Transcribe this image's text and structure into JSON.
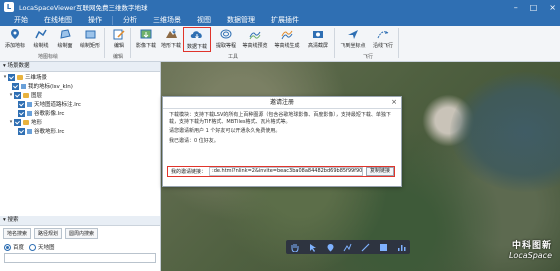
{
  "window": {
    "title": "LocaSpaceViewer互联网免费三维数字地球"
  },
  "menu": [
    "开始",
    "在线地图",
    "操作",
    "分析",
    "三维场景",
    "视图",
    "数据管理",
    "扩展插件"
  ],
  "ribbon": {
    "buttons": [
      "添加地标",
      "绘制线",
      "绘制面",
      "绘制矩形",
      "编辑",
      "影像下载",
      "地形下载",
      "数据下载",
      "提取等程",
      "等高线预览",
      "等高线生成",
      "高清截屏",
      "飞到坐标点",
      "沿线飞行"
    ],
    "groups": [
      "地图标绘",
      "编辑",
      "工具",
      "飞行"
    ]
  },
  "left_panel": {
    "scene_header": "场景数据",
    "tree": [
      "三维场景",
      "我的地标(lsv_kln)",
      "图层",
      "天地图道路标注.lrc",
      "谷歌影像.lrc",
      "地形",
      "谷歌地形.lrc"
    ],
    "search_header": "搜索",
    "search_tabs": [
      "地名搜索",
      "路径规划",
      "圆周内搜索"
    ],
    "sources": [
      "百度",
      "天地图"
    ]
  },
  "dialog": {
    "title": "邀请注册",
    "close": "×",
    "para1": "下载模块：支持下载LSV的所有上百种图源（包含谷歌地球影像、百度影像），支持最短下载、单独下载，支持下载为TIF格式、MBTiles格式、瓦片格式等。",
    "para2": "请您邀请新用户 1 个好友可以开通永久免费使用。",
    "para3": "我已邀请：0 位好友。",
    "link_label": "我的邀请链接：",
    "link_value": ":de.html?nlink=2&invite=beac3ba08a84482bd69b85f99f90e6",
    "copy_label": "复制链接"
  },
  "brand": {
    "cn": "中科图新",
    "en": "LocaSpace"
  }
}
